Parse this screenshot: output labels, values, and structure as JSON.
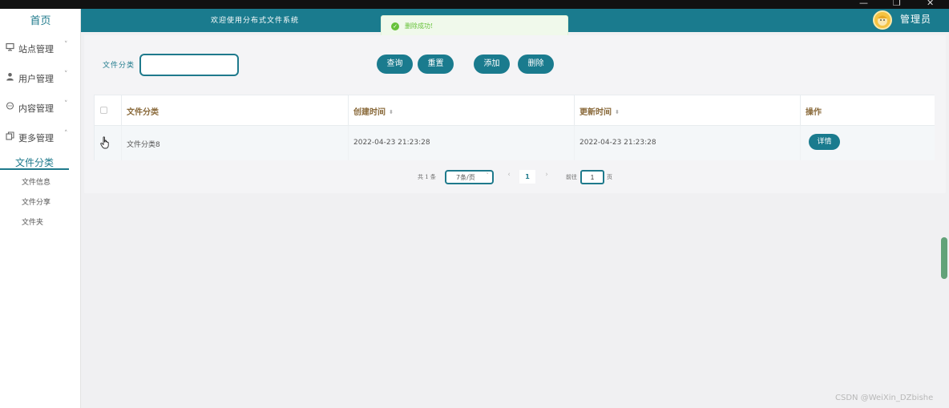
{
  "window": {
    "minimize": "—",
    "restore": "❐",
    "close": "✕"
  },
  "sidebar": {
    "home": "首页",
    "menus": [
      {
        "label": "站点管理",
        "icon": "monitor-icon",
        "arrow": "˅"
      },
      {
        "label": "用户管理",
        "icon": "user-icon",
        "arrow": "˅"
      },
      {
        "label": "内容管理",
        "icon": "chat-icon",
        "arrow": "˅"
      },
      {
        "label": "更多管理",
        "icon": "copy-icon",
        "arrow": "˄"
      }
    ],
    "active_sub": "文件分类",
    "subs": [
      "文件信息",
      "文件分享",
      "文件夹"
    ]
  },
  "header": {
    "welcome": "欢迎使用分布式文件系统",
    "user": "管理员"
  },
  "toast": {
    "message": "删除成功!"
  },
  "search": {
    "label": "文件分类",
    "value": ""
  },
  "buttons": {
    "query": "查询",
    "reset": "重置",
    "add": "添加",
    "delete": "删除"
  },
  "table": {
    "headers": {
      "name": "文件分类",
      "created": "创建时间",
      "updated": "更新时间",
      "ops": "操作"
    },
    "sort_glyph": "⬍",
    "rows": [
      {
        "name": "文件分类8",
        "created": "2022-04-23 21:23:28",
        "updated": "2022-04-23 21:23:28",
        "action": "详情"
      }
    ]
  },
  "pagination": {
    "total": "共 1 条",
    "page_size": "7条/页",
    "prev": "‹",
    "current": "1",
    "next": "›",
    "goto_label": "前往",
    "goto_value": "1",
    "page_suffix": "页"
  },
  "watermark": "CSDN @WeiXin_DZbishe",
  "colors": {
    "primary": "#1a7b8e",
    "toast_green": "#67c23a",
    "header_gold": "#8a6a3b"
  }
}
